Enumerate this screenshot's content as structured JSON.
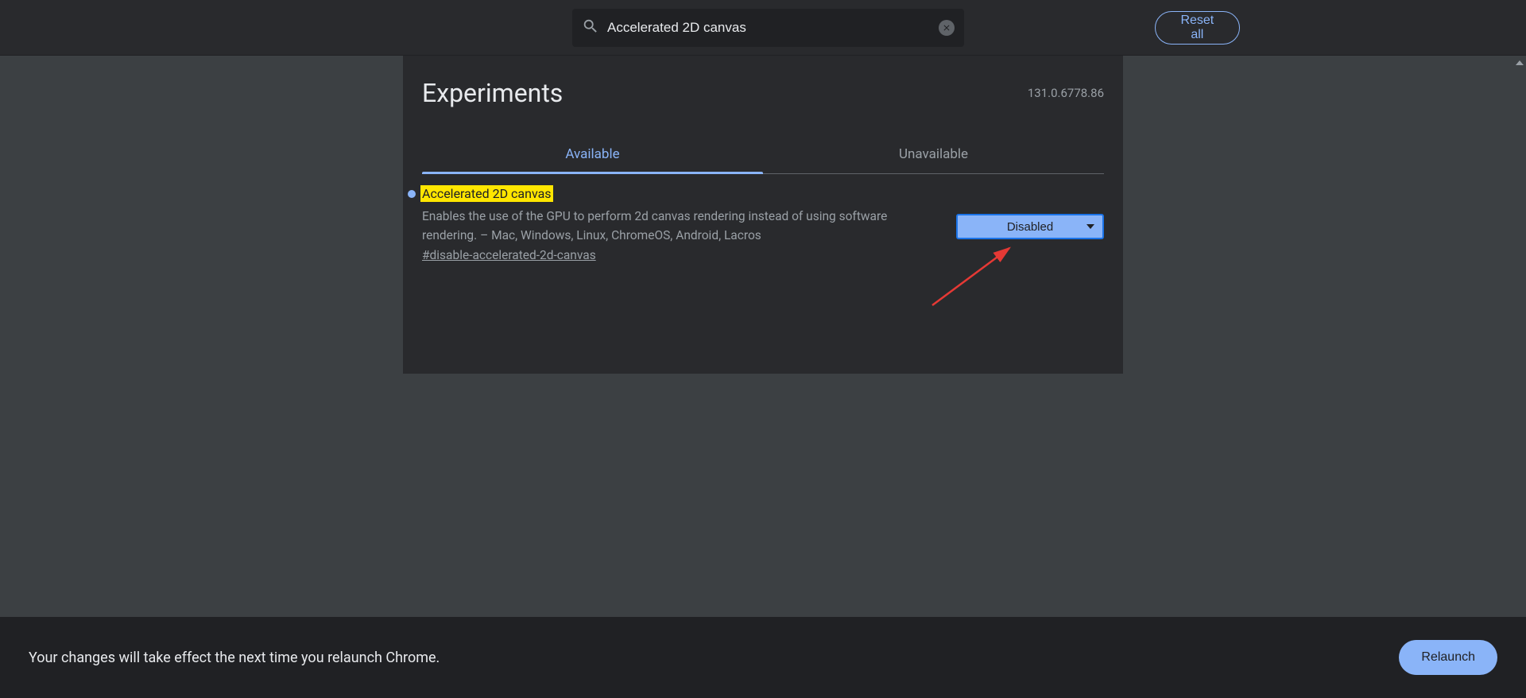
{
  "header": {
    "search_value": "Accelerated 2D canvas",
    "reset_label": "Reset all"
  },
  "panel": {
    "title": "Experiments",
    "version": "131.0.6778.86"
  },
  "tabs": [
    {
      "label": "Available",
      "active": true
    },
    {
      "label": "Unavailable",
      "active": false
    }
  ],
  "flag": {
    "title": "Accelerated 2D canvas",
    "description": "Enables the use of the GPU to perform 2d canvas rendering instead of using software rendering. – Mac, Windows, Linux, ChromeOS, Android, Lacros",
    "hash": "#disable-accelerated-2d-canvas",
    "selected": "Disabled"
  },
  "bottom": {
    "message": "Your changes will take effect the next time you relaunch Chrome.",
    "relaunch_label": "Relaunch"
  }
}
